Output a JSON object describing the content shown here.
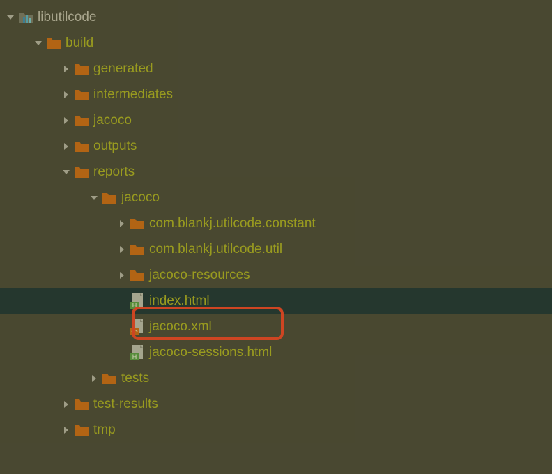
{
  "tree": {
    "root": {
      "label": "libutilcode",
      "expanded": true,
      "icon": "module"
    },
    "build": {
      "label": "build",
      "expanded": true,
      "icon": "folder-orange"
    },
    "generated": {
      "label": "generated",
      "expanded": false,
      "icon": "folder-orange"
    },
    "intermediates": {
      "label": "intermediates",
      "expanded": false,
      "icon": "folder-orange"
    },
    "jacoco": {
      "label": "jacoco",
      "expanded": false,
      "icon": "folder-orange"
    },
    "outputs": {
      "label": "outputs",
      "expanded": false,
      "icon": "folder-orange"
    },
    "reports": {
      "label": "reports",
      "expanded": true,
      "icon": "folder-orange"
    },
    "reports_jacoco": {
      "label": "jacoco",
      "expanded": true,
      "icon": "folder-orange"
    },
    "pkg_constant": {
      "label": "com.blankj.utilcode.constant",
      "expanded": false,
      "icon": "folder-orange"
    },
    "pkg_util": {
      "label": "com.blankj.utilcode.util",
      "expanded": false,
      "icon": "folder-orange"
    },
    "jacoco_resources": {
      "label": "jacoco-resources",
      "expanded": false,
      "icon": "folder-orange"
    },
    "index_html": {
      "label": "index.html",
      "icon": "html"
    },
    "jacoco_xml": {
      "label": "jacoco.xml",
      "icon": "xml"
    },
    "jacoco_sessions": {
      "label": "jacoco-sessions.html",
      "icon": "html"
    },
    "tests": {
      "label": "tests",
      "expanded": false,
      "icon": "folder-orange"
    },
    "test_results": {
      "label": "test-results",
      "expanded": false,
      "icon": "folder-orange"
    },
    "tmp": {
      "label": "tmp",
      "expanded": false,
      "icon": "folder-orange"
    }
  }
}
